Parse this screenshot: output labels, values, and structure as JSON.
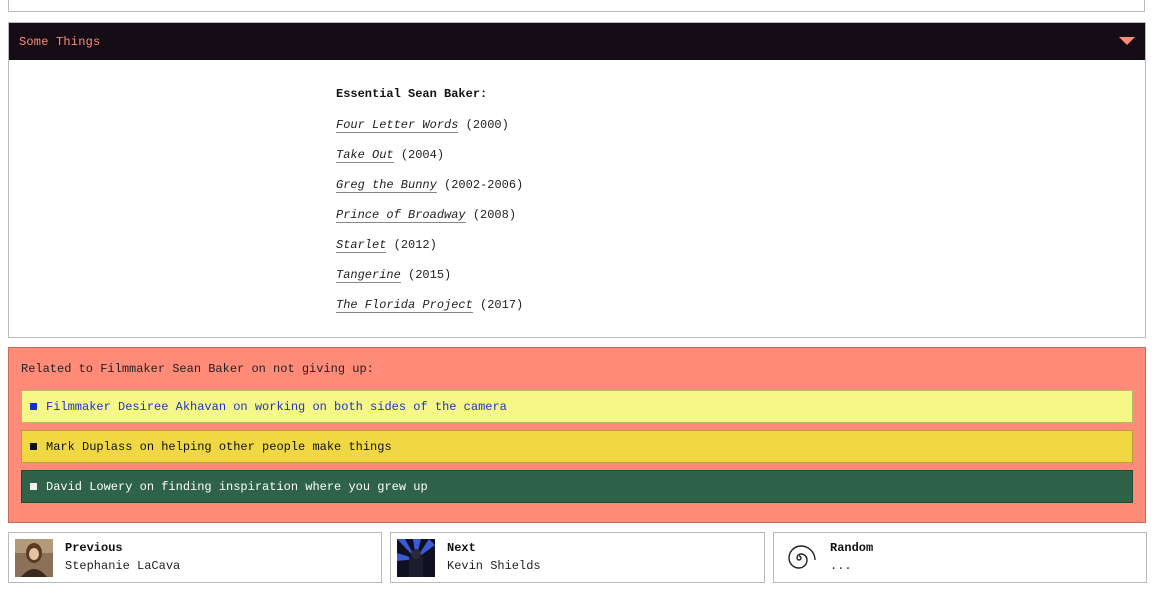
{
  "section": {
    "title": "Some Things",
    "heading": "Essential Sean Baker:",
    "films": [
      {
        "title": "Four Letter Words",
        "year": "(2000)"
      },
      {
        "title": "Take Out",
        "year": "(2004)"
      },
      {
        "title": "Greg the Bunny",
        "year": "(2002-2006)"
      },
      {
        "title": "Prince of Broadway",
        "year": "(2008)"
      },
      {
        "title": "Starlet",
        "year": "(2012)"
      },
      {
        "title": "Tangerine",
        "year": "(2015)"
      },
      {
        "title": "The Florida Project",
        "year": "(2017)"
      }
    ]
  },
  "related": {
    "title": "Related to Filmmaker Sean Baker on not giving up:",
    "items": [
      {
        "label": "Filmmaker Desiree Akhavan on working on both sides of the camera",
        "bg": "#f5f787"
      },
      {
        "label": "Mark Duplass on helping other people make things",
        "bg": "#efd844"
      },
      {
        "label": "David Lowery on finding inspiration where you grew up",
        "bg": "#2e6249"
      }
    ]
  },
  "nav": {
    "previous": {
      "label": "Previous",
      "name": "Stephanie LaCava"
    },
    "next": {
      "label": "Next",
      "name": "Kevin Shields"
    },
    "random": {
      "label": "Random",
      "name": "..."
    }
  },
  "colors": {
    "header_bg": "#160c16",
    "header_text": "#ff8a78",
    "related_bg": "#ff8b78"
  }
}
